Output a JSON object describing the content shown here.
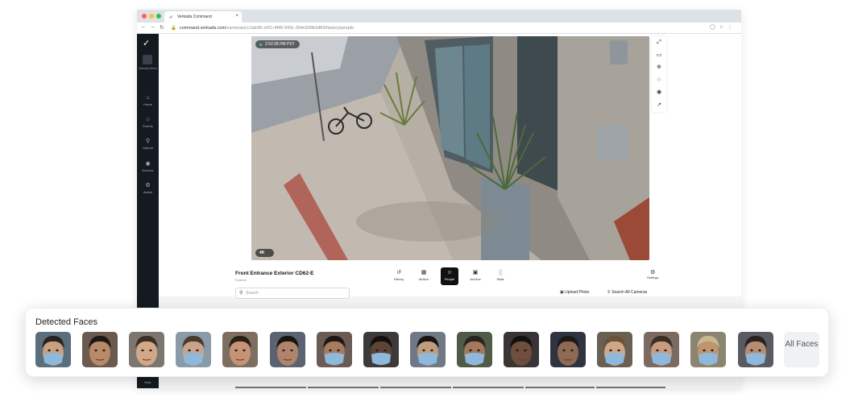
{
  "browser": {
    "tab_title": "Verkada Command",
    "url_host": "command.verkada.com",
    "url_path": "/cameras/cc1ab3fc-ef21-4f45-943c-394c609b3d83/history/people"
  },
  "sidebar": {
    "org_name": "Verkada Demo",
    "items": [
      {
        "label": "Home",
        "icon": "home-icon"
      },
      {
        "label": "Events",
        "icon": "bell-icon"
      },
      {
        "label": "Search",
        "icon": "search-icon"
      },
      {
        "label": "Devices",
        "icon": "devices-icon"
      },
      {
        "label": "Admin",
        "icon": "gear-icon"
      }
    ],
    "help": "Help"
  },
  "video": {
    "timestamp": "2:52:28 PM PST",
    "resolution": "4K"
  },
  "camera": {
    "title": "Front Entrance Exterior CD62-E",
    "subtitle": "Exterior",
    "tabs": [
      {
        "label": "History",
        "icon": "history-icon",
        "active": false
      },
      {
        "label": "Motion",
        "icon": "grid-icon",
        "active": false
      },
      {
        "label": "People",
        "icon": "person-icon",
        "active": true
      },
      {
        "label": "Archive",
        "icon": "archive-icon",
        "active": false
      },
      {
        "label": "Stats",
        "icon": "bar-chart-icon",
        "active": false
      }
    ],
    "settings_label": "Settings",
    "search_placeholder": "Search",
    "upload_label": "Upload Photo",
    "search_all_label": "Search All Cameras"
  },
  "faces": {
    "title": "Detected Faces",
    "all_label": "All Faces",
    "count": 16
  },
  "colors": {
    "sidebar": "#141a20",
    "active_tab": "#111111",
    "live_dot": "#3ddc84"
  }
}
